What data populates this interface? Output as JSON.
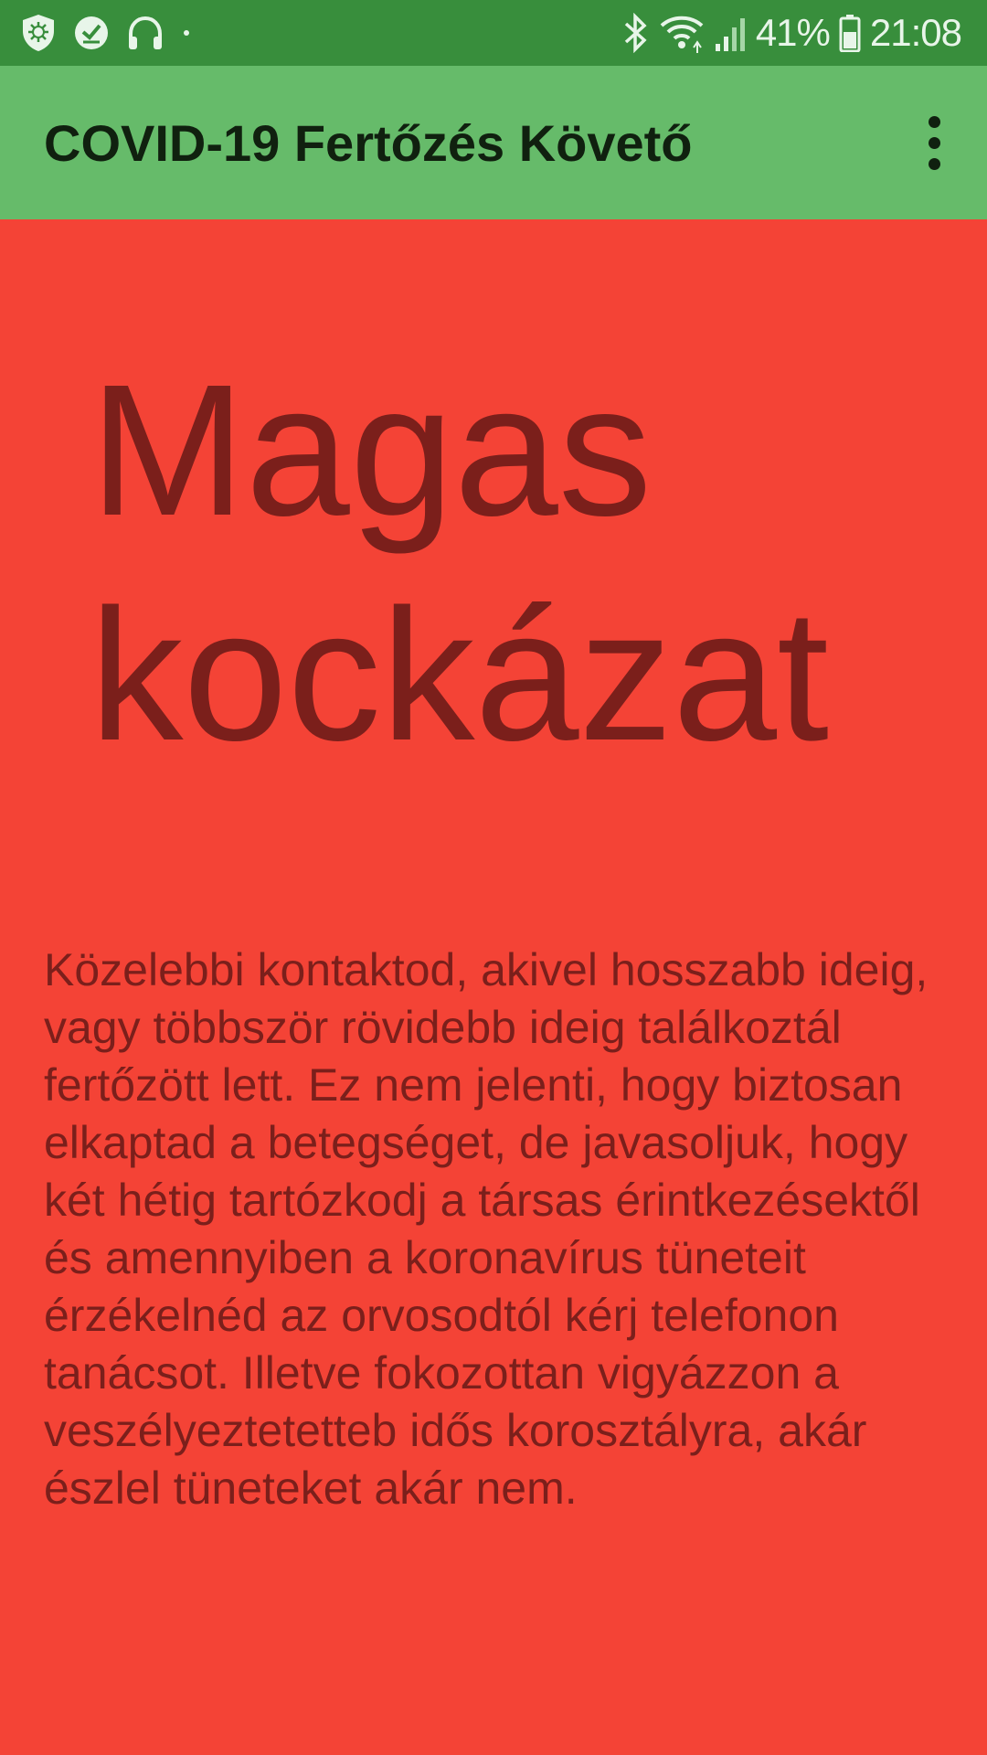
{
  "status_bar": {
    "left_icons": [
      "shield-icon",
      "check-badge-icon",
      "headphones-icon",
      "dot-icon"
    ],
    "right_icons": [
      "bluetooth-icon",
      "wifi-icon",
      "signal-icon",
      "battery-icon"
    ],
    "battery": "41%",
    "time": "21:08"
  },
  "toolbar": {
    "title": "COVID-19 Fertőzés Követő",
    "menu_icon": "more-vert-icon"
  },
  "main": {
    "risk_level": "Magas kockázat",
    "description": "Közelebbi kontaktod, akivel hosszabb ideig, vagy többször rövidebb ideig találkoztál fertőzött lett. Ez nem jelenti, hogy biztosan elkaptad a betegséget, de javasoljuk, hogy két hétig tartózkodj a társas érintkezésektől és amennyiben a koronavírus tüneteit érzékelnéd az orvosodtól kérj telefonon tanácsot. Illetve fokozottan vigyázzon a veszélyeztetetteb idős korosztályra, akár észlel tüneteket akár nem."
  },
  "colors": {
    "status_bar": "#388e3c",
    "toolbar": "#66bb6a",
    "background": "#f44336",
    "text": "#7b1f1b"
  }
}
